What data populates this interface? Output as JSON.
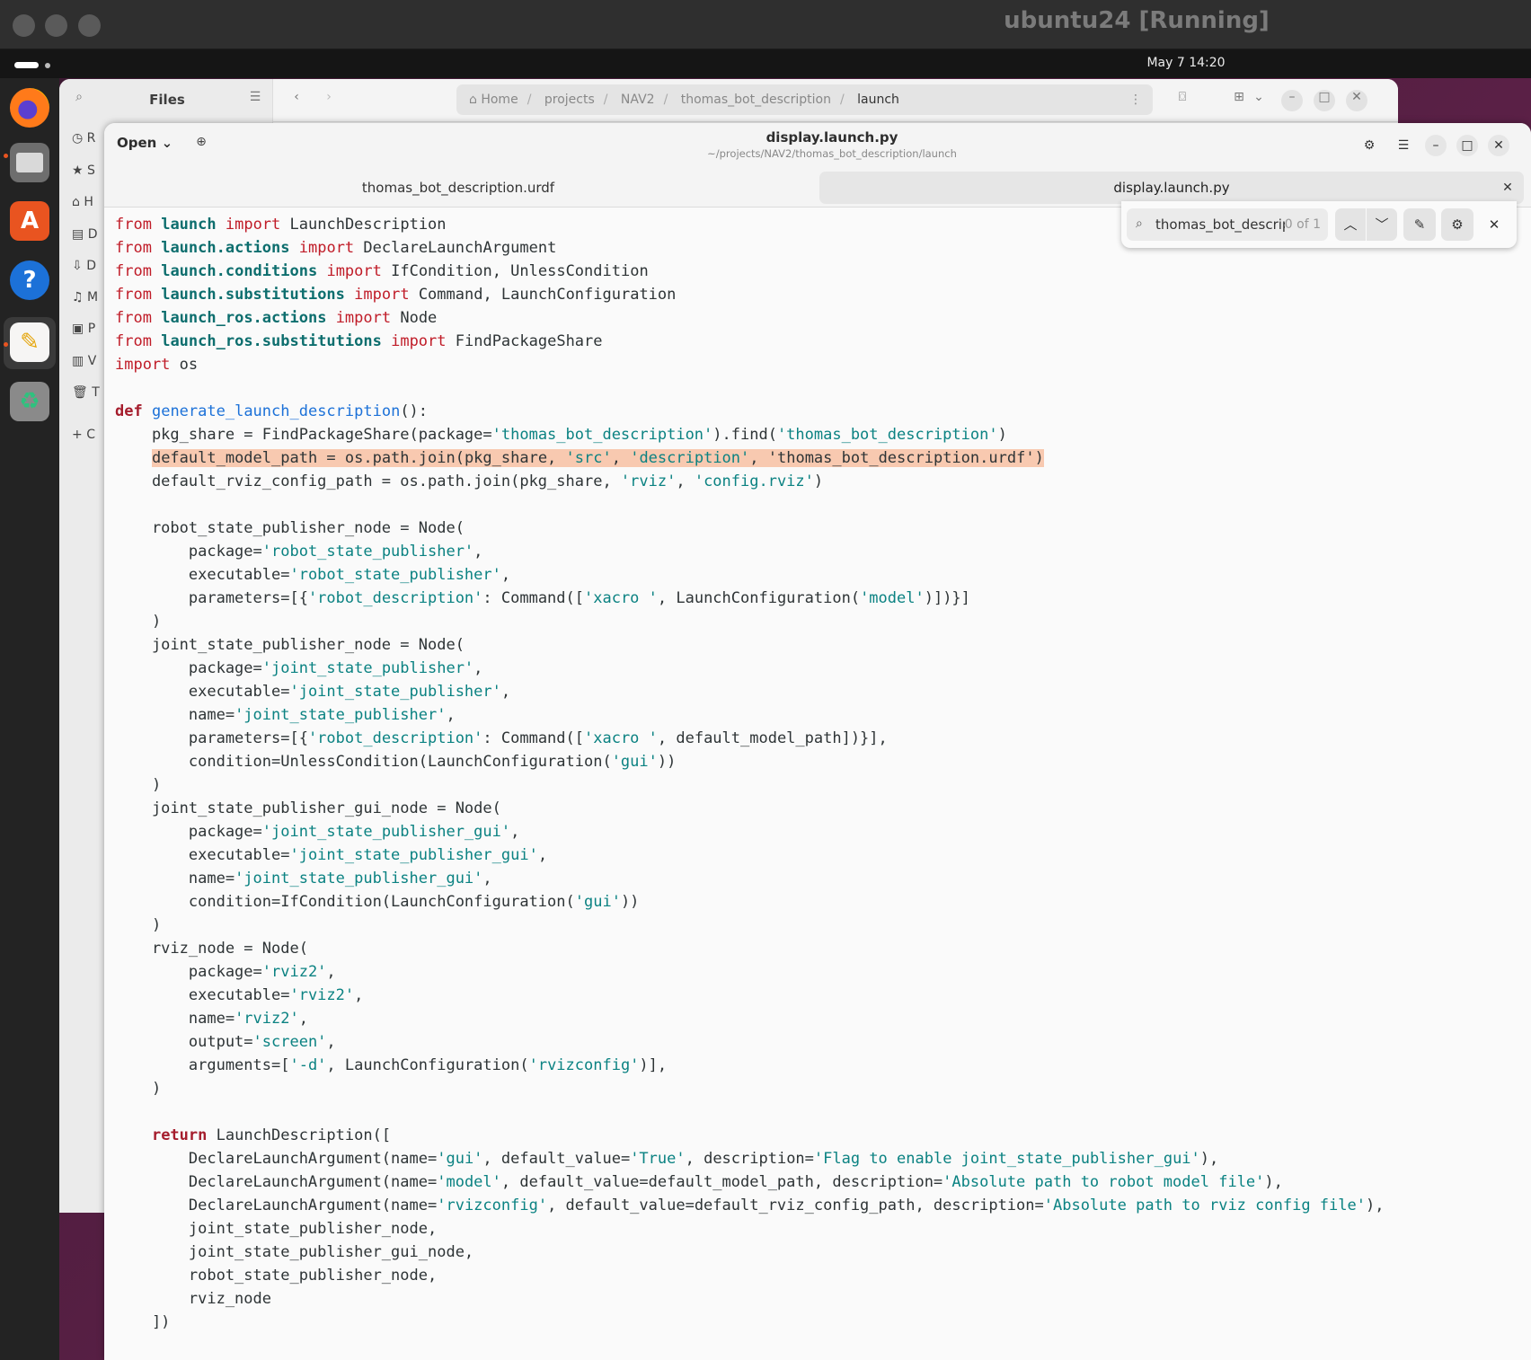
{
  "vm": {
    "title": "ubuntu24 [Running]"
  },
  "topbar": {
    "clock": "May 7  14:20"
  },
  "dock": {
    "items": [
      "firefox-icon",
      "files-icon",
      "app-center-icon",
      "help-icon",
      "text-editor-icon",
      "trash-icon"
    ]
  },
  "files": {
    "title": "Files",
    "path": [
      "Home",
      "projects",
      "NAV2",
      "thomas_bot_description",
      "launch"
    ],
    "sidebar": [
      {
        "icon": "clock-icon",
        "label": "R"
      },
      {
        "icon": "star-icon",
        "label": "S"
      },
      {
        "icon": "home-icon",
        "label": "H"
      },
      {
        "icon": "document-icon",
        "label": "D"
      },
      {
        "icon": "download-icon",
        "label": "D"
      },
      {
        "icon": "music-icon",
        "label": "M"
      },
      {
        "icon": "picture-icon",
        "label": "P"
      },
      {
        "icon": "video-icon",
        "label": "V"
      },
      {
        "icon": "trash-icon",
        "label": "T"
      },
      {
        "icon": "plus-icon",
        "label": "C"
      }
    ]
  },
  "editor": {
    "open_label": "Open",
    "title": "display.launch.py",
    "subtitle": "~/projects/NAV2/thomas_bot_description/launch",
    "tabs": [
      {
        "label": "thomas_bot_description.urdf"
      },
      {
        "label": "display.launch.py"
      }
    ],
    "find": {
      "query": "thomas_bot_descript",
      "count": "0 of 1"
    },
    "code": [
      [
        [
          "from",
          "kw"
        ],
        [
          " "
        ],
        [
          "launch",
          "mod"
        ],
        [
          " "
        ],
        [
          "import",
          "kw"
        ],
        [
          " LaunchDescription"
        ]
      ],
      [
        [
          "from",
          "kw"
        ],
        [
          " "
        ],
        [
          "launch.actions",
          "mod"
        ],
        [
          " "
        ],
        [
          "import",
          "kw"
        ],
        [
          " DeclareLaunchArgument"
        ]
      ],
      [
        [
          "from",
          "kw"
        ],
        [
          " "
        ],
        [
          "launch.conditions",
          "mod"
        ],
        [
          " "
        ],
        [
          "import",
          "kw"
        ],
        [
          " IfCondition, UnlessCondition"
        ]
      ],
      [
        [
          "from",
          "kw"
        ],
        [
          " "
        ],
        [
          "launch.substitutions",
          "mod"
        ],
        [
          " "
        ],
        [
          "import",
          "kw"
        ],
        [
          " Command, LaunchConfiguration"
        ]
      ],
      [
        [
          "from",
          "kw"
        ],
        [
          " "
        ],
        [
          "launch_ros.actions",
          "mod"
        ],
        [
          " "
        ],
        [
          "import",
          "kw"
        ],
        [
          " Node"
        ]
      ],
      [
        [
          "from",
          "kw"
        ],
        [
          " "
        ],
        [
          "launch_ros.substitutions",
          "mod"
        ],
        [
          " "
        ],
        [
          "import",
          "kw"
        ],
        [
          " FindPackageShare"
        ]
      ],
      [
        [
          "import",
          "kw"
        ],
        [
          " os"
        ]
      ],
      [],
      [
        [
          "def",
          "dk2"
        ],
        [
          " "
        ],
        [
          "generate_launch_description",
          "fn"
        ],
        [
          "():"
        ]
      ],
      [
        [
          "    pkg_share = FindPackageShare(package="
        ],
        [
          "'thomas_bot_description'",
          "st"
        ],
        [
          ").find("
        ],
        [
          "'thomas_bot_description'",
          "st"
        ],
        [
          ")"
        ]
      ],
      [
        [
          "    "
        ],
        [
          "default_model_path = os.path.join(pkg_share, ",
          "hl"
        ],
        [
          "'src'",
          "st hl"
        ],
        [
          ", ",
          "hl"
        ],
        [
          "'description'",
          "st hl"
        ],
        [
          ", ",
          "hl"
        ],
        [
          "'thomas_bot_description.urdf'",
          "hl"
        ],
        [
          ")",
          "hl"
        ]
      ],
      [
        [
          "    default_rviz_config_path = os.path.join(pkg_share, "
        ],
        [
          "'rviz'",
          "st"
        ],
        [
          ", "
        ],
        [
          "'config.rviz'",
          "st"
        ],
        [
          ")"
        ]
      ],
      [],
      [
        [
          "    robot_state_publisher_node = Node("
        ]
      ],
      [
        [
          "        package="
        ],
        [
          "'robot_state_publisher'",
          "st"
        ],
        [
          ","
        ]
      ],
      [
        [
          "        executable="
        ],
        [
          "'robot_state_publisher'",
          "st"
        ],
        [
          ","
        ]
      ],
      [
        [
          "        parameters=[{"
        ],
        [
          "'robot_description'",
          "st"
        ],
        [
          ": Command(["
        ],
        [
          "'xacro '",
          "st"
        ],
        [
          ", LaunchConfiguration("
        ],
        [
          "'model'",
          "st"
        ],
        [
          ")])}]"
        ]
      ],
      [
        [
          "    )"
        ]
      ],
      [
        [
          "    joint_state_publisher_node = Node("
        ]
      ],
      [
        [
          "        package="
        ],
        [
          "'joint_state_publisher'",
          "st"
        ],
        [
          ","
        ]
      ],
      [
        [
          "        executable="
        ],
        [
          "'joint_state_publisher'",
          "st"
        ],
        [
          ","
        ]
      ],
      [
        [
          "        name="
        ],
        [
          "'joint_state_publisher'",
          "st"
        ],
        [
          ","
        ]
      ],
      [
        [
          "        parameters=[{"
        ],
        [
          "'robot_description'",
          "st"
        ],
        [
          ": Command(["
        ],
        [
          "'xacro '",
          "st"
        ],
        [
          ", default_model_path])}],"
        ]
      ],
      [
        [
          "        condition=UnlessCondition(LaunchConfiguration("
        ],
        [
          "'gui'",
          "st"
        ],
        [
          "))"
        ]
      ],
      [
        [
          "    )"
        ]
      ],
      [
        [
          "    joint_state_publisher_gui_node = Node("
        ]
      ],
      [
        [
          "        package="
        ],
        [
          "'joint_state_publisher_gui'",
          "st"
        ],
        [
          ","
        ]
      ],
      [
        [
          "        executable="
        ],
        [
          "'joint_state_publisher_gui'",
          "st"
        ],
        [
          ","
        ]
      ],
      [
        [
          "        name="
        ],
        [
          "'joint_state_publisher_gui'",
          "st"
        ],
        [
          ","
        ]
      ],
      [
        [
          "        condition=IfCondition(LaunchConfiguration("
        ],
        [
          "'gui'",
          "st"
        ],
        [
          "))"
        ]
      ],
      [
        [
          "    )"
        ]
      ],
      [
        [
          "    rviz_node = Node("
        ]
      ],
      [
        [
          "        package="
        ],
        [
          "'rviz2'",
          "st"
        ],
        [
          ","
        ]
      ],
      [
        [
          "        executable="
        ],
        [
          "'rviz2'",
          "st"
        ],
        [
          ","
        ]
      ],
      [
        [
          "        name="
        ],
        [
          "'rviz2'",
          "st"
        ],
        [
          ","
        ]
      ],
      [
        [
          "        output="
        ],
        [
          "'screen'",
          "st"
        ],
        [
          ","
        ]
      ],
      [
        [
          "        arguments=["
        ],
        [
          "'-d'",
          "st"
        ],
        [
          ", LaunchConfiguration("
        ],
        [
          "'rvizconfig'",
          "st"
        ],
        [
          ")],"
        ]
      ],
      [
        [
          "    )"
        ]
      ],
      [],
      [
        [
          "    "
        ],
        [
          "return",
          "dk2"
        ],
        [
          " LaunchDescription(["
        ]
      ],
      [
        [
          "        DeclareLaunchArgument(name="
        ],
        [
          "'gui'",
          "st"
        ],
        [
          ", default_value="
        ],
        [
          "'True'",
          "st"
        ],
        [
          ", description="
        ],
        [
          "'Flag to enable joint_state_publisher_gui'",
          "st"
        ],
        [
          "),"
        ]
      ],
      [
        [
          "        DeclareLaunchArgument(name="
        ],
        [
          "'model'",
          "st"
        ],
        [
          ", default_value=default_model_path, description="
        ],
        [
          "'Absolute path to robot model file'",
          "st"
        ],
        [
          "),"
        ]
      ],
      [
        [
          "        DeclareLaunchArgument(name="
        ],
        [
          "'rvizconfig'",
          "st"
        ],
        [
          ", default_value=default_rviz_config_path, description="
        ],
        [
          "'Absolute path to rviz config file'",
          "st"
        ],
        [
          "),"
        ]
      ],
      [
        [
          "        joint_state_publisher_node,"
        ]
      ],
      [
        [
          "        joint_state_publisher_gui_node,"
        ]
      ],
      [
        [
          "        robot_state_publisher_node,"
        ]
      ],
      [
        [
          "        rviz_node"
        ]
      ],
      [
        [
          "    ])"
        ]
      ]
    ]
  },
  "colors": {
    "accent": "#e95420",
    "keyword": "#c01c28",
    "string": "#0b8282",
    "module": "#0d6e6e",
    "function": "#1c71d8",
    "highlight": "#f8c9b0"
  }
}
